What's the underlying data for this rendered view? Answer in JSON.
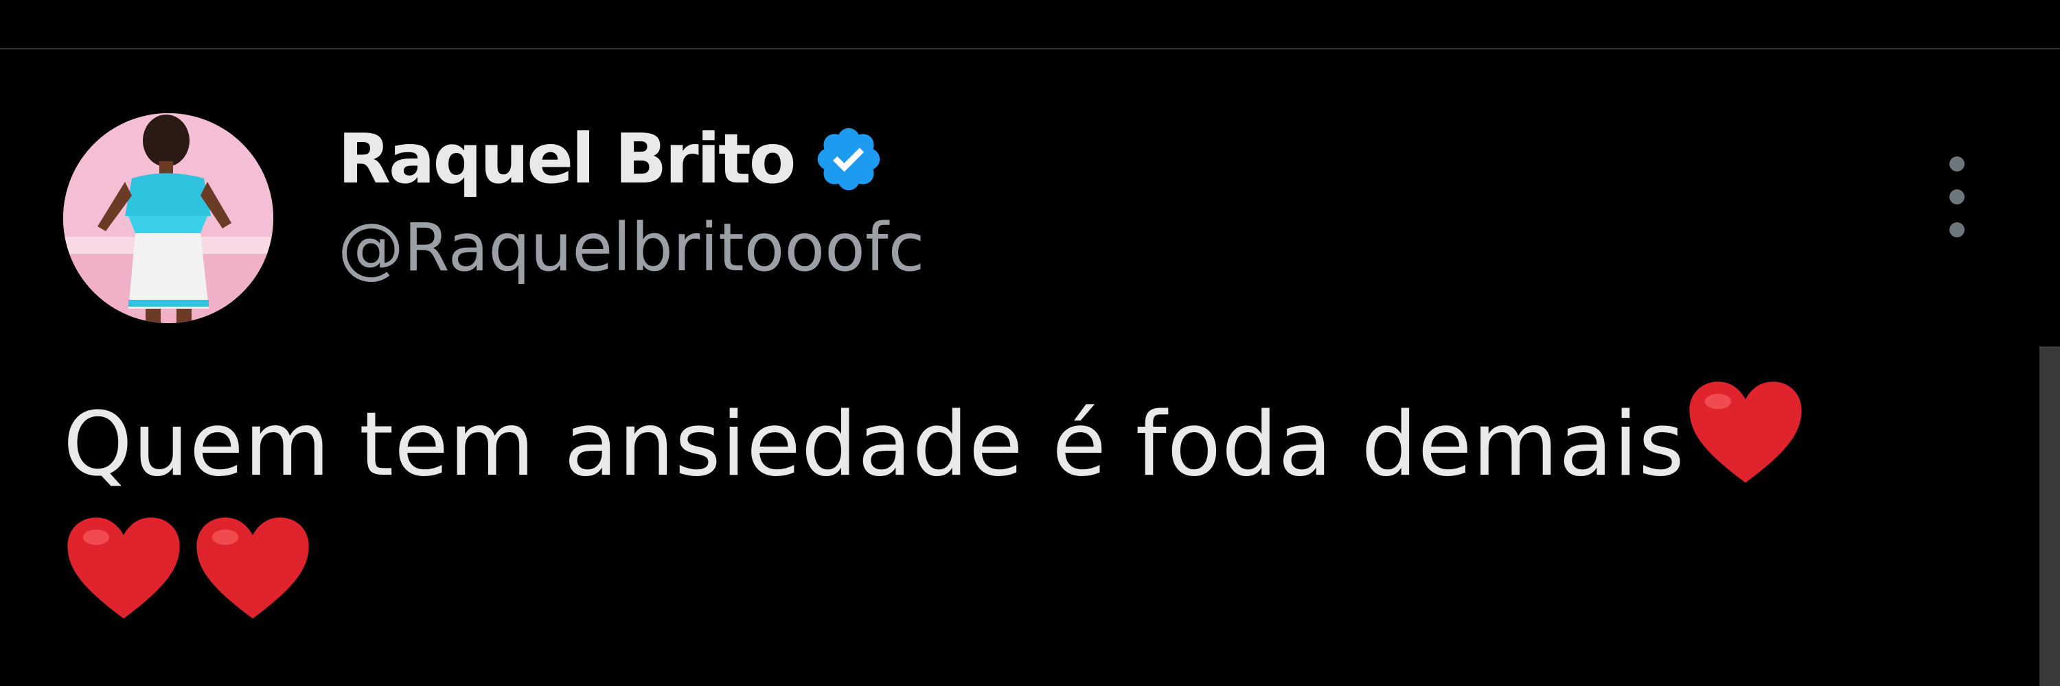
{
  "tweet": {
    "author": {
      "display_name": "Raquel Brito",
      "handle": "@Raquelbritooofc",
      "verified": true,
      "avatar_icon": "profile-photo"
    },
    "text": "Quem tem ansiedade é foda demais",
    "trailing_emoji": [
      "heart-emoji",
      "heart-emoji",
      "heart-emoji"
    ]
  },
  "icons": {
    "verified": "verified-badge-icon",
    "more": "more-options-icon"
  },
  "colors": {
    "background": "#000000",
    "primary_text": "#e7e9ea",
    "secondary_text": "#9aa0a6",
    "verified_blue": "#1d9bf0",
    "heart_red": "#e0242e",
    "divider": "#2f3336"
  }
}
